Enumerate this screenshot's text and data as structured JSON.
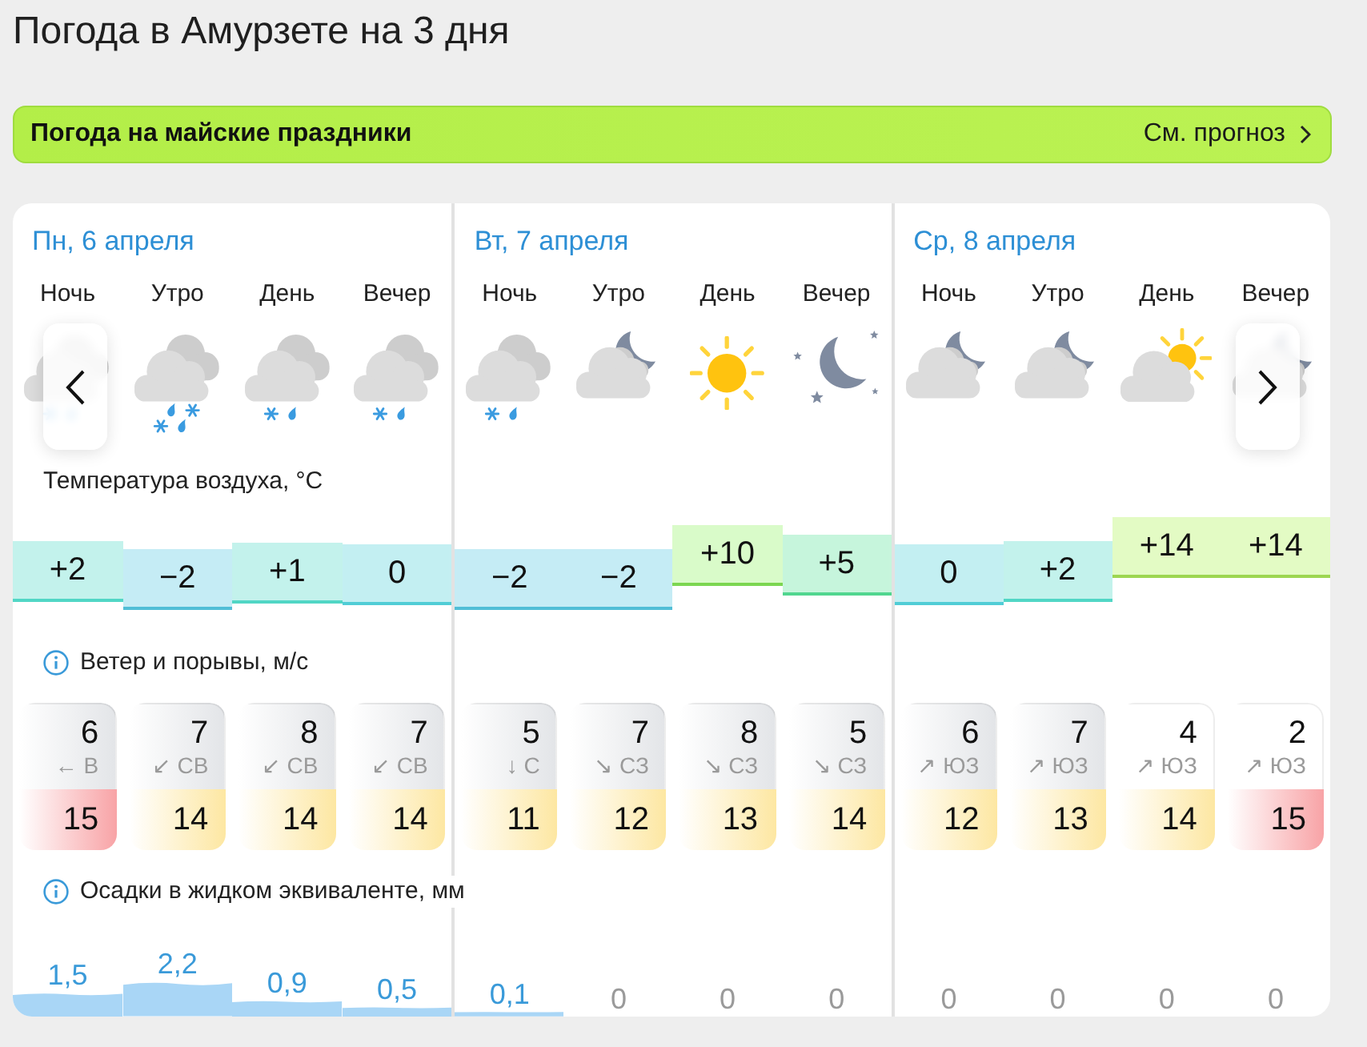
{
  "title": "Погода в Амурзете на 3 дня",
  "banner": {
    "title": "Погода на майские праздники",
    "link": "См. прогноз"
  },
  "sections": {
    "temperature": "Температура воздуха, °C",
    "wind": "Ветер и порывы, м/с",
    "precipitation": "Осадки в жидком эквиваленте, мм"
  },
  "days": [
    {
      "date": "Пн, 6 апреля",
      "periods": [
        {
          "label": "Ночь",
          "kind": "sleet",
          "temperature": {
            "value": "+2",
            "color": "#c3f2ec"
          },
          "wind": {
            "speed": {
              "value": "6",
              "color": "#e3e5e8"
            },
            "direction": "← В",
            "gust": {
              "value": "15",
              "color": "#f8a3a6"
            }
          },
          "precipitation": "1,5"
        },
        {
          "label": "Утро",
          "kind": "sleet_heavy",
          "temperature": {
            "value": "−2",
            "color": "#c5ecf5"
          },
          "wind": {
            "speed": {
              "value": "7",
              "color": "#e3e5e8"
            },
            "direction": "↙ СВ",
            "gust": {
              "value": "14",
              "color": "#fde7a2"
            }
          },
          "precipitation": "2,2"
        },
        {
          "label": "День",
          "kind": "sleet",
          "temperature": {
            "value": "+1",
            "color": "#c3f2ec"
          },
          "wind": {
            "speed": {
              "value": "8",
              "color": "#e3e5e8"
            },
            "direction": "↙ СВ",
            "gust": {
              "value": "14",
              "color": "#fde7a2"
            }
          },
          "precipitation": "0,9"
        },
        {
          "label": "Вечер",
          "kind": "sleet",
          "temperature": {
            "value": "0",
            "color": "#c3eff2"
          },
          "wind": {
            "speed": {
              "value": "7",
              "color": "#e3e5e8"
            },
            "direction": "↙ СВ",
            "gust": {
              "value": "14",
              "color": "#fde7a2"
            }
          },
          "precipitation": "0,5"
        }
      ]
    },
    {
      "date": "Вт, 7 апреля",
      "periods": [
        {
          "label": "Ночь",
          "kind": "sleet",
          "temperature": {
            "value": "−2",
            "color": "#c5ecf5"
          },
          "wind": {
            "speed": {
              "value": "5",
              "color": "#e3e5e8"
            },
            "direction": "↓ С",
            "gust": {
              "value": "11",
              "color": "#fde7a2"
            }
          },
          "precipitation": "0,1"
        },
        {
          "label": "Утро",
          "kind": "cloudy_night",
          "temperature": {
            "value": "−2",
            "color": "#c5ecf5"
          },
          "wind": {
            "speed": {
              "value": "7",
              "color": "#e3e5e8"
            },
            "direction": "↘ СЗ",
            "gust": {
              "value": "12",
              "color": "#fde7a2"
            }
          },
          "precipitation": "0"
        },
        {
          "label": "День",
          "kind": "clear",
          "temperature": {
            "value": "+10",
            "color": "#d9fbc9"
          },
          "wind": {
            "speed": {
              "value": "8",
              "color": "#e3e5e8"
            },
            "direction": "↘ СЗ",
            "gust": {
              "value": "13",
              "color": "#fde7a2"
            }
          },
          "precipitation": "0"
        },
        {
          "label": "Вечер",
          "kind": "clear_night",
          "temperature": {
            "value": "+5",
            "color": "#c6f5dc"
          },
          "wind": {
            "speed": {
              "value": "5",
              "color": "#e3e5e8"
            },
            "direction": "↘ СЗ",
            "gust": {
              "value": "14",
              "color": "#fde7a2"
            }
          },
          "precipitation": "0"
        }
      ]
    },
    {
      "date": "Ср, 8 апреля",
      "periods": [
        {
          "label": "Ночь",
          "kind": "cloudy_night",
          "temperature": {
            "value": "0",
            "color": "#c3eff2"
          },
          "wind": {
            "speed": {
              "value": "6",
              "color": "#e3e5e8"
            },
            "direction": "↗ ЮЗ",
            "gust": {
              "value": "12",
              "color": "#fde7a2"
            }
          },
          "precipitation": "0"
        },
        {
          "label": "Утро",
          "kind": "cloudy_night",
          "temperature": {
            "value": "+2",
            "color": "#c3f2ec"
          },
          "wind": {
            "speed": {
              "value": "7",
              "color": "#e3e5e8"
            },
            "direction": "↗ ЮЗ",
            "gust": {
              "value": "13",
              "color": "#fde7a2"
            }
          },
          "precipitation": "0"
        },
        {
          "label": "День",
          "kind": "cloudy_sun",
          "temperature": {
            "value": "+14",
            "color": "#e3fbc4"
          },
          "wind": {
            "speed": {
              "value": "4",
              "color": "#ffffff"
            },
            "direction": "↗ ЮЗ",
            "gust": {
              "value": "14",
              "color": "#fde7a2"
            }
          },
          "precipitation": "0"
        },
        {
          "label": "Вечер",
          "kind": "cloudy_night",
          "temperature": {
            "value": "+14",
            "color": "#e3fbc4"
          },
          "wind": {
            "speed": {
              "value": "2",
              "color": "#ffffff"
            },
            "direction": "↗ ЮЗ",
            "gust": {
              "value": "15",
              "color": "#f8a3a6"
            }
          },
          "precipitation": "0"
        }
      ]
    }
  ]
}
